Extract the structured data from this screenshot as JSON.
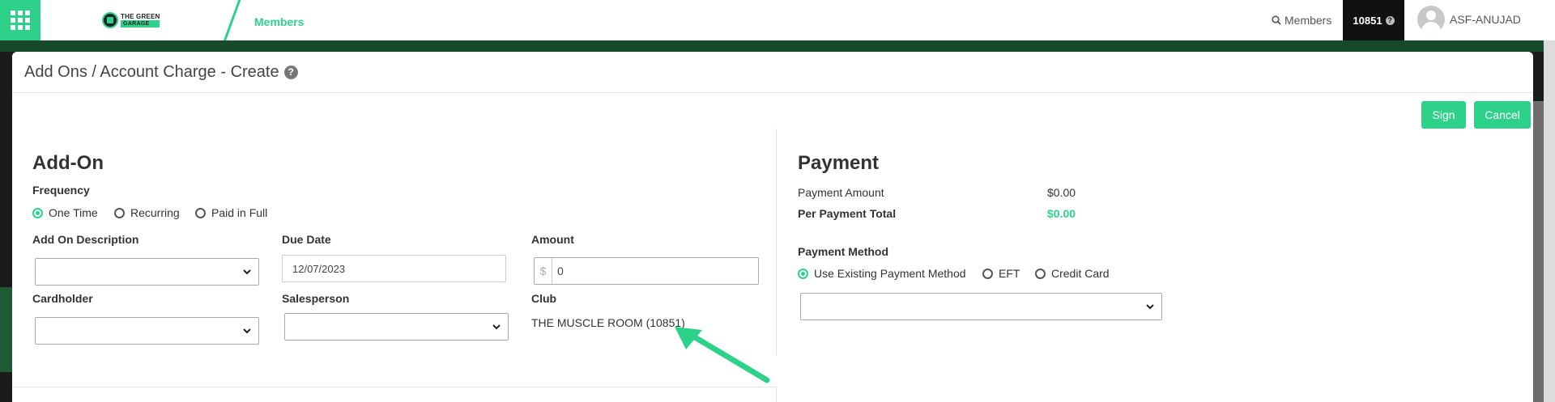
{
  "topbar": {
    "logo_line1": "THE GREEN",
    "logo_line2": "GARAGE",
    "nav_members": "Members",
    "search_label": "Members",
    "club_number": "10851",
    "help_glyph": "?",
    "user_name": "ASF-ANUJAD"
  },
  "modal": {
    "title": "Add Ons / Account Charge - Create",
    "help_glyph": "?",
    "sign_label": "Sign",
    "cancel_label": "Cancel"
  },
  "addon": {
    "title": "Add-On",
    "frequency_label": "Frequency",
    "frequency_options": [
      "One Time",
      "Recurring",
      "Paid in Full"
    ],
    "frequency_selected": "One Time",
    "description_label": "Add On Description",
    "description_value": "",
    "due_date_label": "Due Date",
    "due_date_value": "12/07/2023",
    "amount_label": "Amount",
    "amount_currency": "$",
    "amount_value": "0",
    "cardholder_label": "Cardholder",
    "cardholder_value": "",
    "salesperson_label": "Salesperson",
    "salesperson_value": "",
    "club_label": "Club",
    "club_value": "THE MUSCLE ROOM (10851)"
  },
  "payment": {
    "title": "Payment",
    "amount_label": "Payment Amount",
    "amount_value": "$0.00",
    "total_label": "Per Payment Total",
    "total_value": "$0.00",
    "method_label": "Payment Method",
    "method_options": [
      "Use Existing Payment Method",
      "EFT",
      "Credit Card"
    ],
    "method_selected": "Use Existing Payment Method",
    "method_select_value": ""
  },
  "colors": {
    "accent": "#2ed18a",
    "dark": "#111111"
  },
  "icons": {
    "apps": "apps-grid-icon",
    "search": "search-icon",
    "help": "help-icon",
    "chevron": "chevron-down-icon",
    "annotation": "annotation-arrow-icon"
  }
}
